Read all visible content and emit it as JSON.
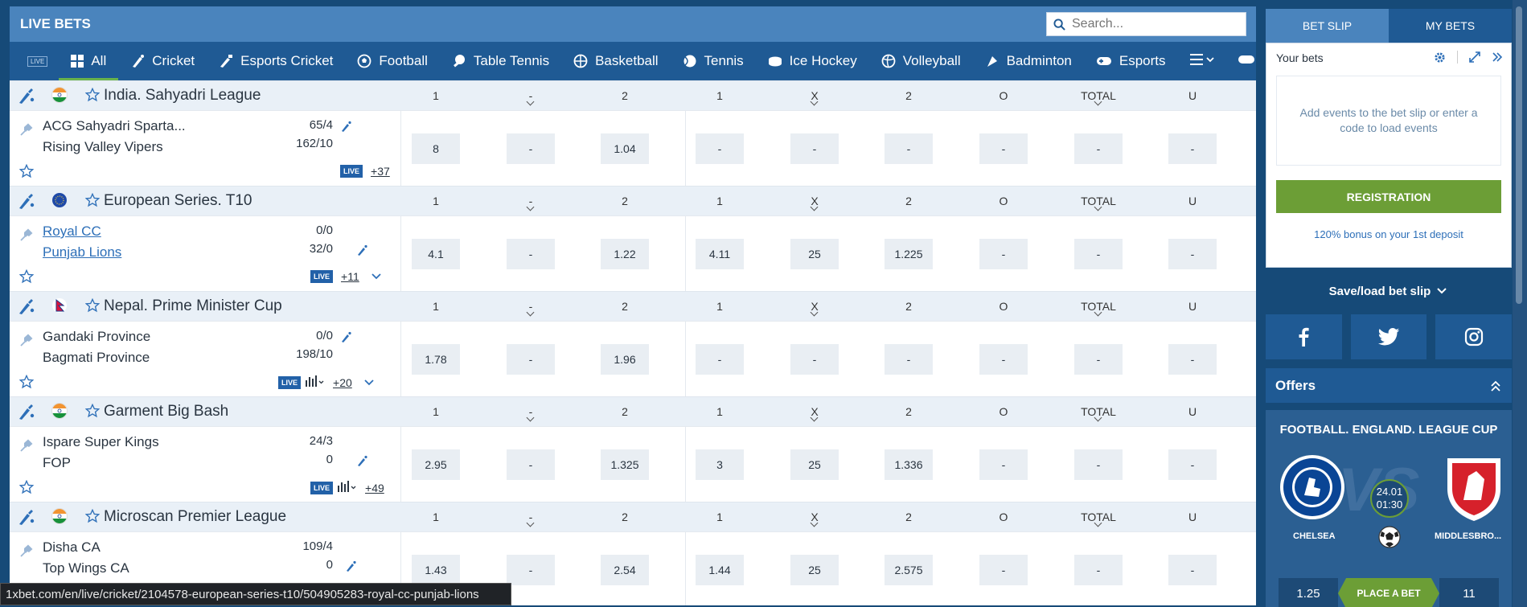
{
  "header": {
    "title": "LIVE BETS",
    "search_placeholder": "Search..."
  },
  "sports": [
    {
      "label": "All",
      "icon": "grid-icon"
    },
    {
      "label": "Cricket",
      "icon": "cricket-icon"
    },
    {
      "label": "Esports Cricket",
      "icon": "esports-cricket-icon"
    },
    {
      "label": "Football",
      "icon": "football-icon"
    },
    {
      "label": "Table Tennis",
      "icon": "table-tennis-icon"
    },
    {
      "label": "Basketball",
      "icon": "basketball-icon"
    },
    {
      "label": "Tennis",
      "icon": "tennis-icon"
    },
    {
      "label": "Ice Hockey",
      "icon": "ice-hockey-icon"
    },
    {
      "label": "Volleyball",
      "icon": "volleyball-icon"
    },
    {
      "label": "Badminton",
      "icon": "badminton-icon"
    },
    {
      "label": "Esports",
      "icon": "gamepad-icon"
    }
  ],
  "live_badge": "LIVE",
  "columns": [
    "1",
    "-",
    "2",
    "1",
    "X",
    "2",
    "O",
    "TOTAL",
    "U"
  ],
  "leagues": [
    {
      "name": "India. Sahyadri League",
      "flag": "india",
      "team1": "ACG Sahyadri Sparta...",
      "team2": "Rising Valley Vipers",
      "score1": "65/4",
      "score2": "162/10",
      "more": "+37",
      "odds": [
        "8",
        "-",
        "1.04",
        "-",
        "-",
        "-",
        "-",
        "-",
        "-"
      ]
    },
    {
      "name": "European Series. T10",
      "flag": "europe",
      "team1": "Royal CC",
      "team2": "Punjab Lions",
      "score1": "0/0",
      "score2": "32/0",
      "more": "+11",
      "odds": [
        "4.1",
        "-",
        "1.22",
        "4.11",
        "25",
        "1.225",
        "-",
        "-",
        "-"
      ]
    },
    {
      "name": "Nepal. Prime Minister Cup",
      "flag": "nepal",
      "team1": "Gandaki Province",
      "team2": "Bagmati Province",
      "score1": "0/0",
      "score2": "198/10",
      "more": "+20",
      "odds": [
        "1.78",
        "-",
        "1.96",
        "-",
        "-",
        "-",
        "-",
        "-",
        "-"
      ]
    },
    {
      "name": "Garment Big Bash",
      "flag": "india",
      "team1": "Ispare Super Kings",
      "team2": "FOP",
      "score1": "24/3",
      "score2": "0",
      "more": "+49",
      "odds": [
        "2.95",
        "-",
        "1.325",
        "3",
        "25",
        "1.336",
        "-",
        "-",
        "-"
      ]
    },
    {
      "name": "Microscan Premier League",
      "flag": "india",
      "team1": "Disha CA",
      "team2": "Top Wings CA",
      "score1": "109/4",
      "score2": "0",
      "more": "",
      "odds": [
        "1.43",
        "-",
        "2.54",
        "1.44",
        "25",
        "2.575",
        "-",
        "-",
        "-"
      ]
    }
  ],
  "status_url": "1xbet.com/en/live/cricket/2104578-european-series-t10/504905283-royal-cc-punjab-lions",
  "betslip": {
    "tab_slip": "BET SLIP",
    "tab_mine": "MY BETS",
    "your_bets": "Your bets",
    "empty_text": "Add events to the bet slip or enter a code to load events",
    "registration": "REGISTRATION",
    "bonus": "120% bonus on your 1st deposit",
    "saveload": "Save/load bet slip"
  },
  "offers": {
    "header": "Offers",
    "title": "FOOTBALL. ENGLAND. LEAGUE CUP",
    "vs": "VS",
    "date": "24.01",
    "time": "01:30",
    "team1": "CHELSEA",
    "team2": "MIDDLESBRO...",
    "odd1": "1.25",
    "place": "PLACE A BET",
    "odd2": "11"
  },
  "colors": {
    "brand": "#1f5a94",
    "accent": "#6c9e36",
    "header": "#4a84bd"
  }
}
